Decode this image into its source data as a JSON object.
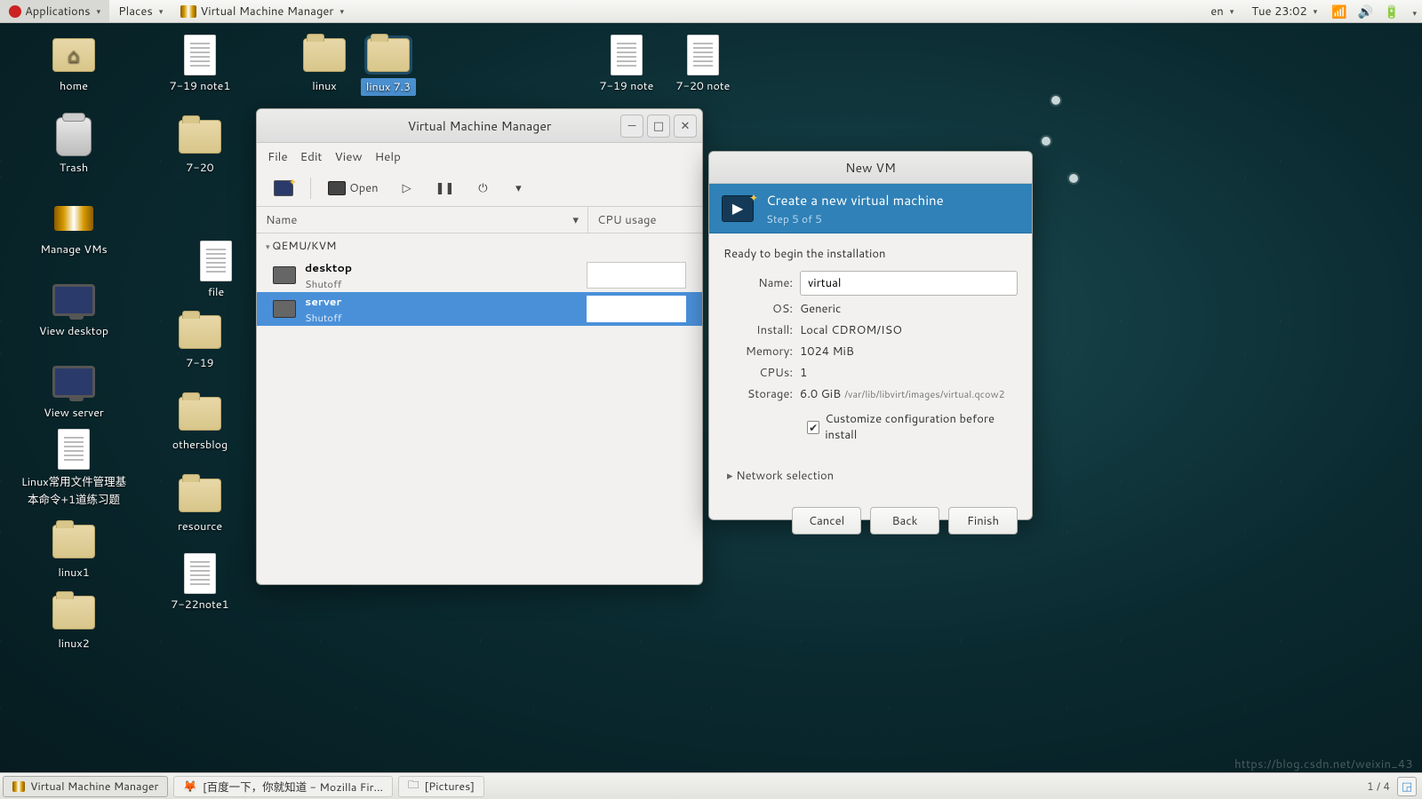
{
  "panel": {
    "applications": "Applications",
    "places": "Places",
    "app_title": "Virtual Machine Manager",
    "lang": "en",
    "clock": "Tue 23:02"
  },
  "desktop_icons": {
    "home": "home",
    "note719": "7-19 note1",
    "linux": "linux",
    "linux73": "linux 7.3",
    "note719b": "7-19 note",
    "note720": "7-20 note",
    "trash": "Trash",
    "f720": "7-20",
    "managevms": "Manage VMs",
    "file": "file",
    "viewdesktop": "View desktop",
    "f719": "7-19",
    "viewserver": "View server",
    "othersblog": "othersblog",
    "linuxdoc": "Linux常用文件管理基本命令+1道练习题",
    "resource": "resource",
    "linux1": "linux1",
    "note722": "7-22note1",
    "linux2": "linux2"
  },
  "vmm": {
    "title": "Virtual Machine Manager",
    "menu": {
      "file": "File",
      "edit": "Edit",
      "view": "View",
      "help": "Help"
    },
    "toolbar_open": "Open",
    "cols": {
      "name": "Name",
      "cpu": "CPU usage"
    },
    "group": "QEMU/KVM",
    "vms": [
      {
        "name": "desktop",
        "status": "Shutoff"
      },
      {
        "name": "server",
        "status": "Shutoff"
      }
    ]
  },
  "dlg": {
    "title": "New VM",
    "hero_title": "Create a new virtual machine",
    "hero_sub": "Step 5 of 5",
    "ready": "Ready to begin the installation",
    "labels": {
      "name": "Name:",
      "os": "OS:",
      "install": "Install:",
      "memory": "Memory:",
      "cpus": "CPUs:",
      "storage": "Storage:"
    },
    "values": {
      "name": "virtual",
      "os": "Generic",
      "install": "Local CDROM/ISO",
      "memory": "1024 MiB",
      "cpus": "1",
      "storage_size": "6.0 GiB",
      "storage_path": "/var/lib/libvirt/images/virtual.qcow2"
    },
    "customize_chk": "Customize configuration before install",
    "network": "Network selection",
    "buttons": {
      "cancel": "Cancel",
      "back": "Back",
      "finish": "Finish"
    }
  },
  "taskbar": {
    "t1": "Virtual Machine Manager",
    "t2": "[百度一下，你就知道 - Mozilla Fir...",
    "t3": "[Pictures]",
    "pager": "1 / 4"
  },
  "watermark": "https://blog.csdn.net/weixin_43"
}
